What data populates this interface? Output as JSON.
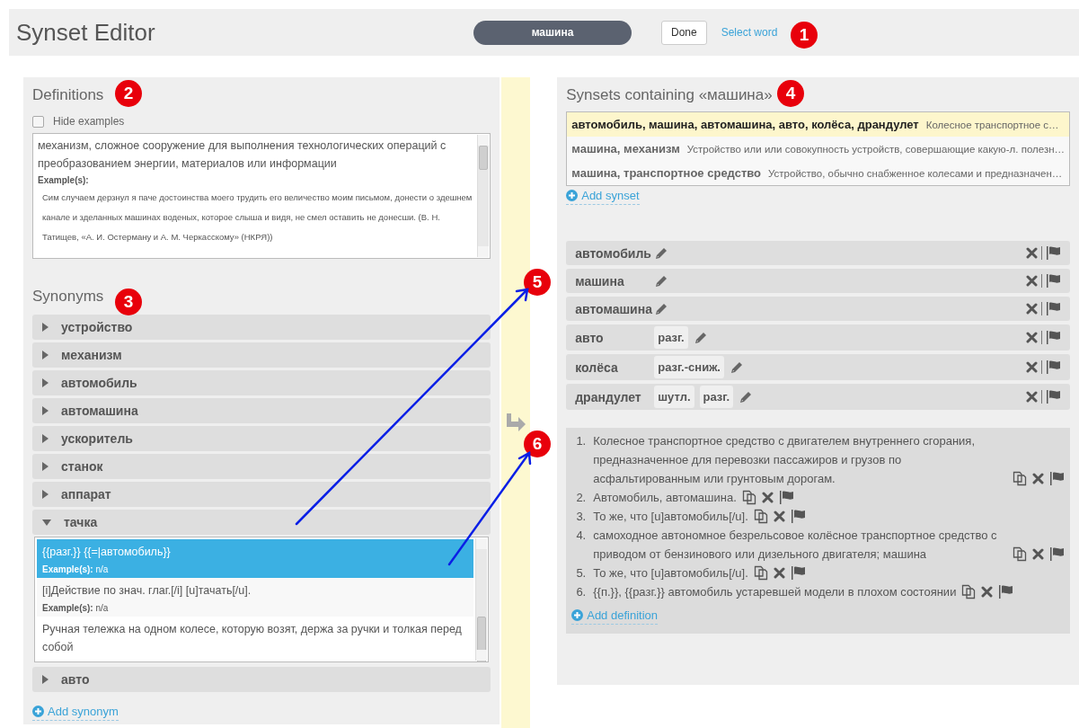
{
  "header": {
    "title": "Synset Editor",
    "word": "машина",
    "done_button": "Done",
    "select_word_link": "Select word"
  },
  "definitions_panel": {
    "title": "Definitions",
    "hide_examples": {
      "label": "Hide examples",
      "checked": false
    },
    "entries": [
      {
        "text": "механизм, сложное сооружение для выполнения технологических операций с преобразованием энергии, материалов или информации",
        "example_label": "Example(s):",
        "example": "Сим случаем дерзнул я паче достоинства моего трудить его величество моим письмом, донести о здешнем канале и зделанных машинах воденых, которое слыша и видя, не смел оставить не донесши. (В. Н. Татищев, «А. И. Остерману и А. М. Черкасскому» (НКРЯ))"
      }
    ]
  },
  "synonyms_panel": {
    "title": "Synonyms",
    "items": [
      {
        "word": "устройство",
        "expanded": false
      },
      {
        "word": "механизм",
        "expanded": false
      },
      {
        "word": "автомобиль",
        "expanded": false
      },
      {
        "word": "автомашина",
        "expanded": false
      },
      {
        "word": "ускоритель",
        "expanded": false
      },
      {
        "word": "станок",
        "expanded": false
      },
      {
        "word": "аппарат",
        "expanded": false
      },
      {
        "word": "тачка",
        "expanded": true,
        "definitions": [
          {
            "text": "{{разг.}} {{=|автомобиль}}",
            "example_label": "Example(s):",
            "example": "n/a",
            "selected": true
          },
          {
            "text": "[i]Действие по знач. глаг.[/i] [u]тачать[/u].",
            "example_label": "Example(s):",
            "example": "n/a",
            "selected": false
          },
          {
            "text": "Ручная тележка на одном колесе, которую возят, держа за ручки и толкая перед собой",
            "selected": false
          }
        ]
      },
      {
        "word": "авто",
        "expanded": false
      }
    ],
    "add_link": "Add synonym"
  },
  "synsets_panel": {
    "title": "Synsets containing «машина»",
    "synsets": [
      {
        "words": "автомобиль, машина, автомашина, авто, колёса, драндулет",
        "gloss": "Колесное транспортное с…",
        "selected": true
      },
      {
        "words": "машина, механизм",
        "gloss": "Устройство или или совокупность устройств, совершающие какую-л. полезн…",
        "selected": false
      },
      {
        "words": "машина, транспортное средство",
        "gloss": "Устройство, обычно снабженное колесами и предназначен…",
        "selected": false
      }
    ],
    "add_synset_link": "Add synset",
    "words": [
      {
        "word": "автомобиль"
      },
      {
        "word": "машина"
      },
      {
        "word": "автомашина"
      },
      {
        "word": "авто",
        "tags": [
          "разг."
        ]
      },
      {
        "word": "колёса",
        "tags": [
          "разг.-сниж."
        ]
      },
      {
        "word": "драндулет",
        "tags": [
          "шутл.",
          "разг."
        ]
      }
    ],
    "definitions": [
      {
        "number": "1.",
        "text": "Колесное транспортное средство с двигателем внутреннего сгорания, предназначенное для перевозки пассажиров и грузов по асфальтированным или грунтовым дорогам."
      },
      {
        "number": "2.",
        "text": "Автомобиль, автомашина."
      },
      {
        "number": "3.",
        "text": "То же, что [u]автомобиль[/u]."
      },
      {
        "number": "4.",
        "text": "самоходное автономное безрельсовое колёсное транспортное средство с приводом от бензинового или дизельного двигателя; машина"
      },
      {
        "number": "5.",
        "text": "То же, что [u]автомобиль[/u]."
      },
      {
        "number": "6.",
        "text": "{{п.}}, {{разг.}} автомобиль устаревшей модели в плохом состоянии"
      }
    ],
    "add_definition_link": "Add definition"
  },
  "callouts": [
    {
      "label": "1"
    },
    {
      "label": "2"
    },
    {
      "label": "3"
    },
    {
      "label": "4"
    },
    {
      "label": "5"
    },
    {
      "label": "6"
    }
  ]
}
